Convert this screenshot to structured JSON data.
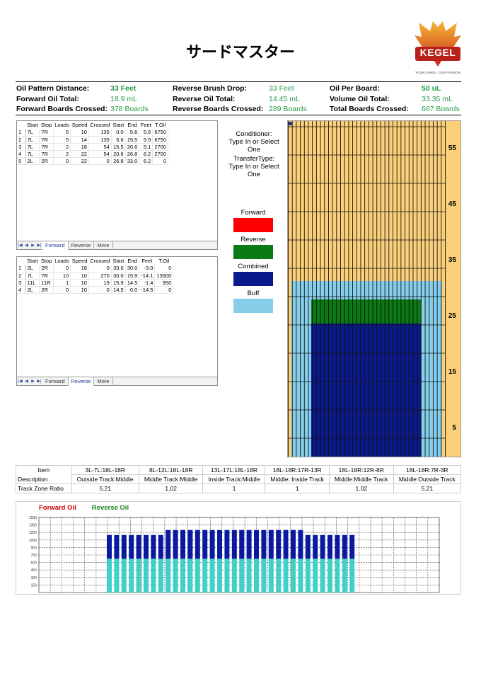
{
  "title": "サードマスター",
  "logo": {
    "brand": "KEGEL",
    "tagline": "YOUR LANES · OUR PASSION"
  },
  "summary": {
    "rows": [
      [
        {
          "label": "Oil Pattern Distance:",
          "value": "33 Feet",
          "bold": true
        },
        {
          "label": "Reverse Brush Drop:",
          "value": "33 Feet",
          "bold": false
        },
        {
          "label": "Oil Per Board:",
          "value": "50 uL",
          "bold": true
        }
      ],
      [
        {
          "label": "Forward Oil Total:",
          "value": "18.9 mL",
          "bold": false
        },
        {
          "label": "Reverse Oil Total:",
          "value": "14.45 mL",
          "bold": false
        },
        {
          "label": "Volume Oil Total:",
          "value": "33.35 mL",
          "bold": false
        }
      ],
      [
        {
          "label": "Forward Boards Crossed:",
          "value": "378 Boards",
          "bold": false
        },
        {
          "label": "Reverse Boards Crossed:",
          "value": "289 Boards",
          "bold": false
        },
        {
          "label": "Total Boards Crossed:",
          "value": "667 Boards",
          "bold": false
        }
      ]
    ]
  },
  "table_headers": [
    "Start",
    "Stop",
    "Loads",
    "Speed",
    "Crossed",
    "Start",
    "End",
    "Feet",
    "T.Oil"
  ],
  "forward_table": {
    "rows": [
      [
        "1",
        "7L",
        "7R",
        "5",
        "10",
        "135",
        "0.0",
        "5.6",
        "5.6",
        "6750"
      ],
      [
        "2",
        "7L",
        "7R",
        "5",
        "14",
        "135",
        "5.6",
        "15.5",
        "9.9",
        "6750"
      ],
      [
        "3",
        "7L",
        "7R",
        "2",
        "18",
        "54",
        "15.5",
        "20.6",
        "5.1",
        "2700"
      ],
      [
        "4",
        "7L",
        "7R",
        "2",
        "22",
        "54",
        "20.6",
        "26.8",
        "6.2",
        "2700"
      ],
      [
        "5",
        "2L",
        "2R",
        "0",
        "22",
        "0",
        "26.8",
        "33.0",
        "6.2",
        "0"
      ]
    ],
    "tabs": [
      "Forward",
      "Reverse",
      "More"
    ],
    "active_tab": "Forward"
  },
  "reverse_table": {
    "rows": [
      [
        "1",
        "2L",
        "2R",
        "0",
        "18",
        "0",
        "33.0",
        "30.0",
        "-3.0",
        "0"
      ],
      [
        "2",
        "7L",
        "7R",
        "10",
        "10",
        "270",
        "30.0",
        "15.9",
        "-14.1",
        "13500"
      ],
      [
        "3",
        "11L",
        "11R",
        "1",
        "10",
        "19",
        "15.9",
        "14.5",
        "-1.4",
        "950"
      ],
      [
        "4",
        "2L",
        "2R",
        "0",
        "10",
        "0",
        "14.5",
        "0.0",
        "-14.5",
        "0"
      ]
    ],
    "tabs": [
      "Forward",
      "Reverse",
      "More"
    ],
    "active_tab": "Reverse"
  },
  "conditioner": {
    "line1": "Conditioner:",
    "line2": "Type In or Select",
    "line3": "One",
    "line4": "TransferType:",
    "line5": "Type In or Select",
    "line6": "One"
  },
  "legend": [
    {
      "label": "Forward",
      "color": "#ff0000"
    },
    {
      "label": "Reverse",
      "color": "#0a7a12"
    },
    {
      "label": "Combined",
      "color": "#0a1a8a"
    },
    {
      "label": "Buff",
      "color": "#87ceeb"
    }
  ],
  "lane_graph": {
    "yard_labels": [
      "55",
      "45",
      "35",
      "25",
      "15",
      "5"
    ],
    "colors": {
      "lane": "#fcd07a",
      "buff": "#87ceeb",
      "reverse": "#0a7a12",
      "combined": "#0a1a8a"
    }
  },
  "track_zone": {
    "item_label": "Item",
    "description_label": "Description",
    "ratio_label": "Track Zone Ratio",
    "columns": [
      {
        "item": "3L-7L:18L-18R",
        "description": "Outside Track:Middle",
        "ratio": "5.21"
      },
      {
        "item": "8L-12L:18L-18R",
        "description": "Middle Track:Middle",
        "ratio": "1.02"
      },
      {
        "item": "13L-17L:18L-18R",
        "description": "Inside Track:Middle",
        "ratio": "1"
      },
      {
        "item": "18L-18R:17R-13R",
        "description": "Middle: Inside Track",
        "ratio": "1"
      },
      {
        "item": "18L-18R:12R-8R",
        "description": "Middle:Middle Track",
        "ratio": "1.02"
      },
      {
        "item": "18L-18R:7R-3R",
        "description": "Middle:Outside Track",
        "ratio": "5.21"
      }
    ]
  },
  "chart_data": {
    "type": "bar",
    "legend": [
      {
        "name": "Forward Oil",
        "color": "#d40000"
      },
      {
        "name": "Reverse Oil",
        "color": "#1a8a1a"
      }
    ],
    "y_ticks": [
      "1500",
      "1350",
      "1200",
      "1050",
      "900",
      "750",
      "600",
      "450",
      "300",
      "150"
    ],
    "ylim": [
      0,
      1500
    ],
    "categories": 39,
    "series": [
      {
        "color": "#40d0c8",
        "values": [
          0,
          0,
          0,
          0,
          0,
          0,
          0,
          0,
          0,
          0,
          0,
          0,
          0,
          0,
          0,
          675,
          675,
          675,
          675,
          675,
          675,
          675,
          675,
          675,
          675,
          675,
          675,
          675,
          675,
          675,
          675,
          675,
          675,
          675,
          675,
          675,
          675,
          675,
          675,
          675,
          675,
          675,
          675,
          675,
          675,
          675,
          675,
          675,
          675,
          0,
          0,
          0,
          0,
          0,
          0,
          0,
          0,
          0,
          0,
          0,
          0,
          0,
          0
        ]
      },
      {
        "color": "#0a1aa0",
        "values": [
          0,
          0,
          0,
          0,
          0,
          0,
          0,
          0,
          0,
          0,
          0,
          0,
          0,
          0,
          0,
          475,
          475,
          475,
          475,
          475,
          475,
          475,
          475,
          575,
          575,
          575,
          575,
          575,
          575,
          575,
          575,
          575,
          575,
          575,
          575,
          575,
          575,
          575,
          575,
          575,
          575,
          575,
          475,
          475,
          475,
          475,
          475,
          475,
          475,
          0,
          0,
          0,
          0,
          0,
          0,
          0,
          0,
          0,
          0,
          0,
          0,
          0,
          0
        ]
      }
    ]
  }
}
